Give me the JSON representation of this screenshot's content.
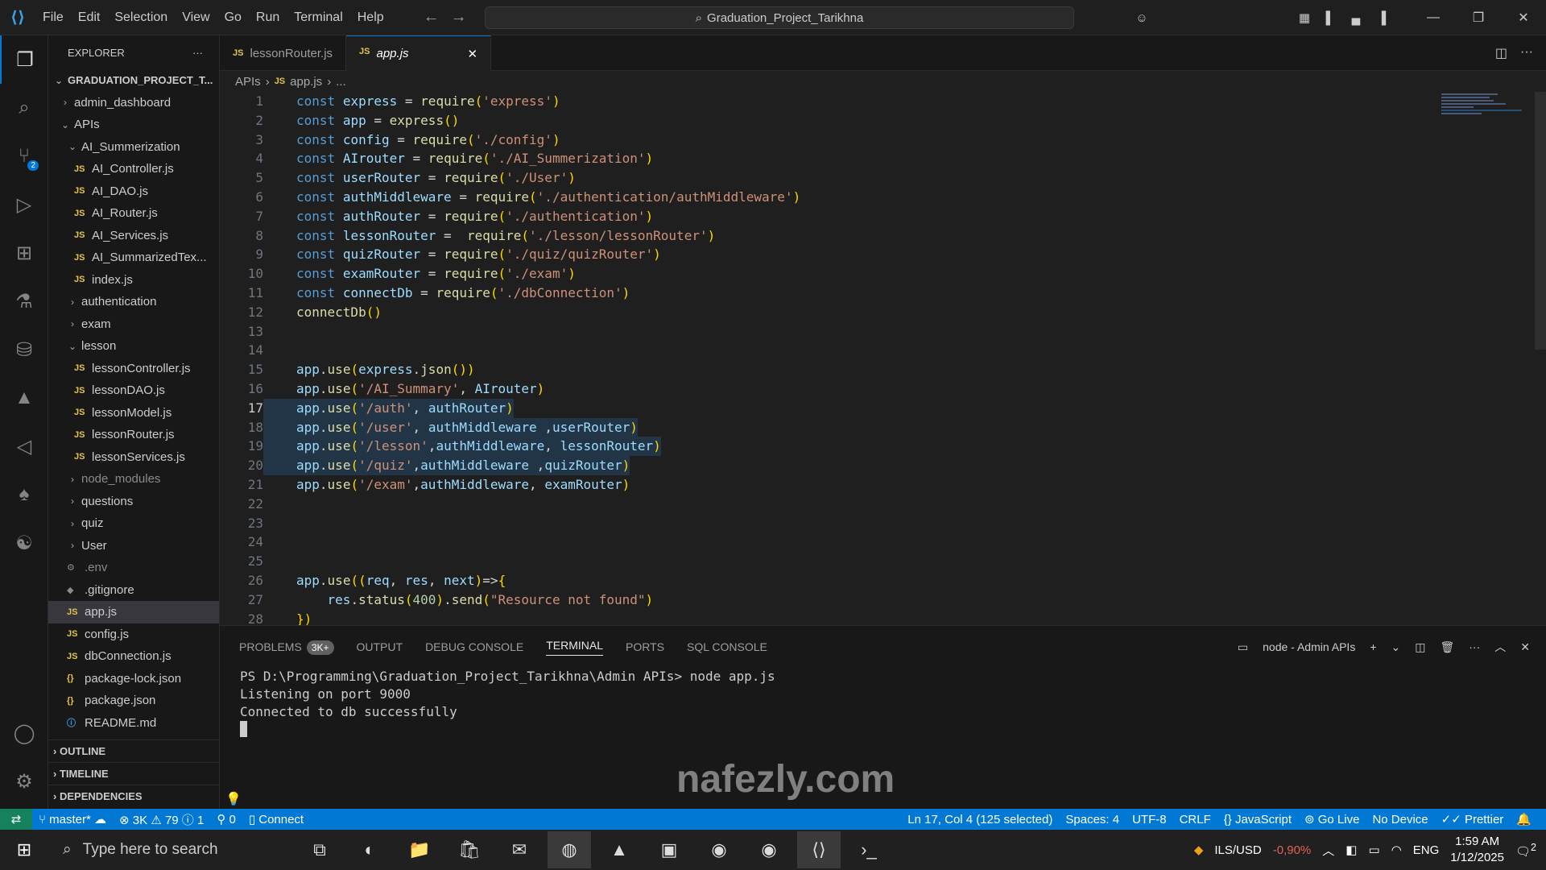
{
  "menu": [
    "File",
    "Edit",
    "Selection",
    "View",
    "Go",
    "Run",
    "Terminal",
    "Help"
  ],
  "command_center": "Graduation_Project_Tarikhna",
  "sidebar": {
    "title": "EXPLORER",
    "project": "GRADUATION_PROJECT_T...",
    "tree": [
      {
        "label": "admin_dashboard",
        "type": "folder",
        "indent": 0,
        "state": "closed"
      },
      {
        "label": "APIs",
        "type": "folder",
        "indent": 0,
        "state": "open"
      },
      {
        "label": "AI_Summerization",
        "type": "folder",
        "indent": 1,
        "state": "open"
      },
      {
        "label": "AI_Controller.js",
        "type": "js",
        "indent": 2
      },
      {
        "label": "AI_DAO.js",
        "type": "js",
        "indent": 2
      },
      {
        "label": "AI_Router.js",
        "type": "js",
        "indent": 2
      },
      {
        "label": "AI_Services.js",
        "type": "js",
        "indent": 2
      },
      {
        "label": "AI_SummarizedTex...",
        "type": "js",
        "indent": 2
      },
      {
        "label": "index.js",
        "type": "js",
        "indent": 2
      },
      {
        "label": "authentication",
        "type": "folder",
        "indent": 1,
        "state": "closed"
      },
      {
        "label": "exam",
        "type": "folder",
        "indent": 1,
        "state": "closed"
      },
      {
        "label": "lesson",
        "type": "folder",
        "indent": 1,
        "state": "open"
      },
      {
        "label": "lessonController.js",
        "type": "js",
        "indent": 2
      },
      {
        "label": "lessonDAO.js",
        "type": "js",
        "indent": 2
      },
      {
        "label": "lessonModel.js",
        "type": "js",
        "indent": 2
      },
      {
        "label": "lessonRouter.js",
        "type": "js",
        "indent": 2
      },
      {
        "label": "lessonServices.js",
        "type": "js",
        "indent": 2
      },
      {
        "label": "node_modules",
        "type": "folder",
        "indent": 1,
        "state": "closed",
        "dim": true
      },
      {
        "label": "questions",
        "type": "folder",
        "indent": 1,
        "state": "closed"
      },
      {
        "label": "quiz",
        "type": "folder",
        "indent": 1,
        "state": "closed"
      },
      {
        "label": "User",
        "type": "folder",
        "indent": 1,
        "state": "closed"
      },
      {
        "label": ".env",
        "type": "gear",
        "indent": 1,
        "dim": true
      },
      {
        "label": ".gitignore",
        "type": "git",
        "indent": 1
      },
      {
        "label": "app.js",
        "type": "js",
        "indent": 1,
        "selected": true
      },
      {
        "label": "config.js",
        "type": "js",
        "indent": 1
      },
      {
        "label": "dbConnection.js",
        "type": "js",
        "indent": 1
      },
      {
        "label": "package-lock.json",
        "type": "json",
        "indent": 1
      },
      {
        "label": "package.json",
        "type": "json",
        "indent": 1
      },
      {
        "label": "README.md",
        "type": "info",
        "indent": 1
      }
    ],
    "sections": [
      "OUTLINE",
      "TIMELINE",
      "DEPENDENCIES"
    ]
  },
  "tabs": [
    {
      "label": "lessonRouter.js",
      "active": false
    },
    {
      "label": "app.js",
      "active": true
    }
  ],
  "breadcrumb": [
    "APIs",
    "app.js",
    "..."
  ],
  "code": [
    "const express = require('express')",
    "const app = express()",
    "const config = require('./config')",
    "const AIrouter = require('./AI_Summerization')",
    "const userRouter = require('./User')",
    "const authMiddleware = require('./authentication/authMiddleware')",
    "const authRouter = require('./authentication')",
    "const lessonRouter =  require('./lesson/lessonRouter')",
    "const quizRouter = require('./quiz/quizRouter')",
    "const examRouter = require('./exam')",
    "const connectDb = require('./dbConnection')",
    "connectDb()",
    "",
    "",
    "app.use(express.json())",
    "app.use('/AI_Summary', AIrouter)",
    "app.use('/auth', authRouter)",
    "app.use('/user', authMiddleware ,userRouter)",
    "app.use('/lesson',authMiddleware, lessonRouter)",
    "app.use('/quiz',authMiddleware ,quizRouter)",
    "app.use('/exam',authMiddleware, examRouter)",
    "",
    "",
    "",
    "",
    "app.use((req, res, next)=>{",
    "    res.status(400).send(\"Resource not found\")",
    "})"
  ],
  "current_line": 17,
  "panel": {
    "tabs": [
      "PROBLEMS",
      "OUTPUT",
      "DEBUG CONSOLE",
      "TERMINAL",
      "PORTS",
      "SQL CONSOLE"
    ],
    "problems_badge": "3K+",
    "active_tab": "TERMINAL",
    "terminal_name": "node - Admin APIs",
    "lines": [
      "PS D:\\Programming\\Graduation_Project_Tarikhna\\Admin APIs> node app.js",
      "Listening on port 9000",
      "Connected to db successfully"
    ]
  },
  "status": {
    "branch": "master*",
    "errors": "3K",
    "warnings": "79",
    "info": "1",
    "ports": "0",
    "connect": "Connect",
    "position": "Ln 17, Col 4 (125 selected)",
    "spaces": "Spaces: 4",
    "encoding": "UTF-8",
    "eol": "CRLF",
    "language": "JavaScript",
    "golive": "Go Live",
    "device": "No Device",
    "prettier": "Prettier"
  },
  "taskbar": {
    "search_placeholder": "Type here to search",
    "currency": "ILS/USD",
    "currency_change": "-0,90%",
    "lang": "ENG",
    "time": "1:59 AM",
    "date": "1/12/2025",
    "notif": "2"
  },
  "watermark": "nafezly.com",
  "colors": {
    "accent": "#0078d4",
    "status_remote": "#16825d",
    "js_icon": "#e3c44c"
  }
}
